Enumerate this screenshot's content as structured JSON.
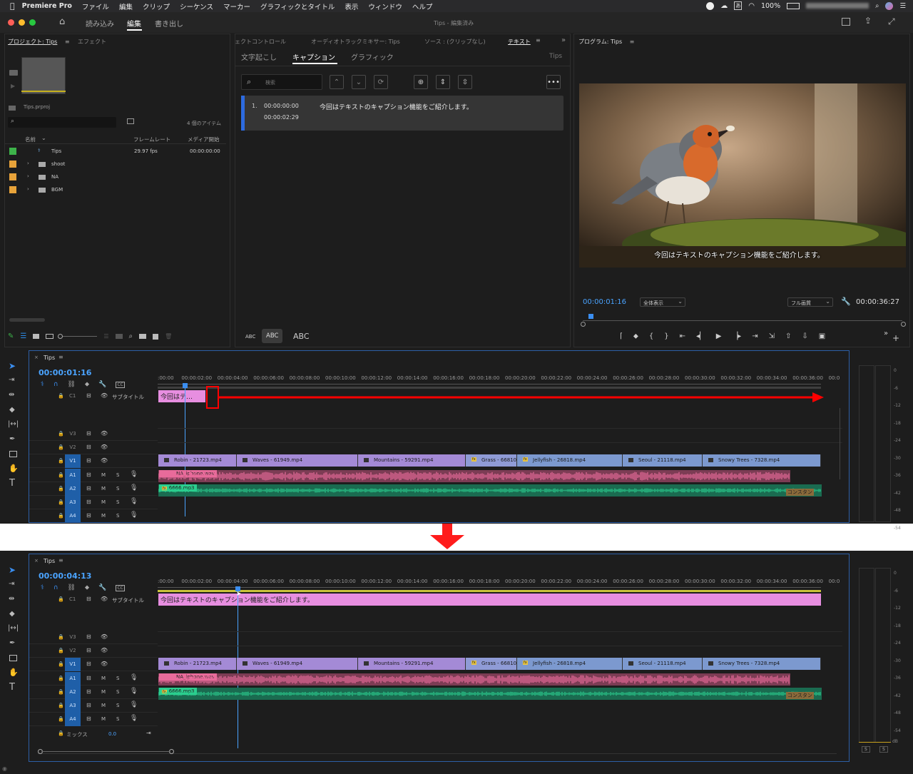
{
  "menubar": {
    "app": "Premiere Pro",
    "items": [
      "ファイル",
      "編集",
      "クリップ",
      "シーケンス",
      "マーカー",
      "グラフィックとタイトル",
      "表示",
      "ウィンドウ",
      "ヘルプ"
    ],
    "battery": "100%"
  },
  "appbar": {
    "tabs": [
      "読み込み",
      "編集",
      "書き出し"
    ],
    "title": "Tips - 編集済み"
  },
  "project": {
    "tab": "プロジェクト: Tips",
    "tab2": "エフェクト",
    "file": "Tips.prproj",
    "count": "4 個のアイテム",
    "cols": [
      "名前",
      "フレームレート",
      "メディア開始"
    ],
    "rows": [
      {
        "name": "Tips",
        "fps": "29.97 fps",
        "start": "00:00:00:00",
        "color": "#3db34a",
        "kind": "seq"
      },
      {
        "name": "shoot",
        "fps": "",
        "start": "",
        "color": "#e8a33a",
        "kind": "folder"
      },
      {
        "name": "NA",
        "fps": "",
        "start": "",
        "color": "#e8a33a",
        "kind": "folder"
      },
      {
        "name": "BGM",
        "fps": "",
        "start": "",
        "color": "#e8a33a",
        "kind": "folder"
      }
    ]
  },
  "text_panel": {
    "tabs": [
      "ェクトコントロール",
      "オーディオトラックミキサー: Tips",
      "ソース : (クリップなし)",
      "テキスト"
    ],
    "subtabs": [
      "文字起こし",
      "キャプション",
      "グラフィック"
    ],
    "seq": "Tips",
    "search_placeholder": "検索",
    "caption": {
      "num": "1.",
      "in": "00:00:00:00",
      "out": "00:00:02:29",
      "text": "今回はテキストのキャプション機能をご紹介します。"
    },
    "sizes": [
      "ABC",
      "ABC",
      "ABC"
    ]
  },
  "program": {
    "tab": "プログラム: Tips",
    "subtitle": "今回はテキストのキャプション機能をご紹介します。",
    "timecode": "00:00:01:16",
    "fit": "全体表示",
    "quality": "フル画質",
    "duration": "00:00:36:27"
  },
  "timeline_top": {
    "tab": "Tips",
    "timecode": "00:00:01:16",
    "caption_clip": "今回はテ…"
  },
  "timeline_bottom": {
    "tab": "Tips",
    "timecode": "00:00:04:13",
    "caption_clip": "今回はテキストのキャプション機能をご紹介します。",
    "mix": "ミックス",
    "mix_val": "0.0"
  },
  "ruler": [
    ":00:00",
    "00:00:02:00",
    "00:00:04:00",
    "00:00:06:00",
    "00:00:08:00",
    "00:00:10:00",
    "00:00:12:00",
    "00:00:14:00",
    "00:00:16:00",
    "00:00:18:00",
    "00:00:20:00",
    "00:00:22:00",
    "00:00:24:00",
    "00:00:26:00",
    "00:00:28:00",
    "00:00:30:00",
    "00:00:32:00",
    "00:00:34:00",
    "00:00:36:00",
    "00:0"
  ],
  "tracks": {
    "caption": "C1",
    "caption_name": "サブタイトル",
    "video": [
      "V3",
      "V2",
      "V1"
    ],
    "audio": [
      "A1",
      "A2",
      "A3",
      "A4"
    ]
  },
  "video_clips": [
    {
      "name": "Robin - 21723.mp4",
      "fx": false
    },
    {
      "name": "Waves - 61949.mp4",
      "fx": false
    },
    {
      "name": "Mountains - 59291.mp4",
      "fx": false
    },
    {
      "name": "Grass - 66810.",
      "fx": true
    },
    {
      "name": "Jellyfish - 26818.mp4",
      "fx": true
    },
    {
      "name": "Seoul - 21118.mp4",
      "fx": false
    },
    {
      "name": "Snowy Trees - 7328.mp4",
      "fx": false
    }
  ],
  "audio_clips": {
    "a1": "NA_iphone.wav",
    "a2": "6666.mp3",
    "a2_end": "コンスタン"
  },
  "meter_scale": [
    "0",
    "-6",
    "-12",
    "-18",
    "-24",
    "-30",
    "-36",
    "-42",
    "-48",
    "-54"
  ],
  "meter_bottom": [
    "dB",
    "S",
    "S"
  ],
  "colors": {
    "accent": "#2d8ceb",
    "caption_clip": "#e78ee0",
    "video_clip": "#a48ad6",
    "audio_na": "#d06a8a",
    "audio_bgm": "#27a777",
    "annotation": "#ff0000"
  }
}
